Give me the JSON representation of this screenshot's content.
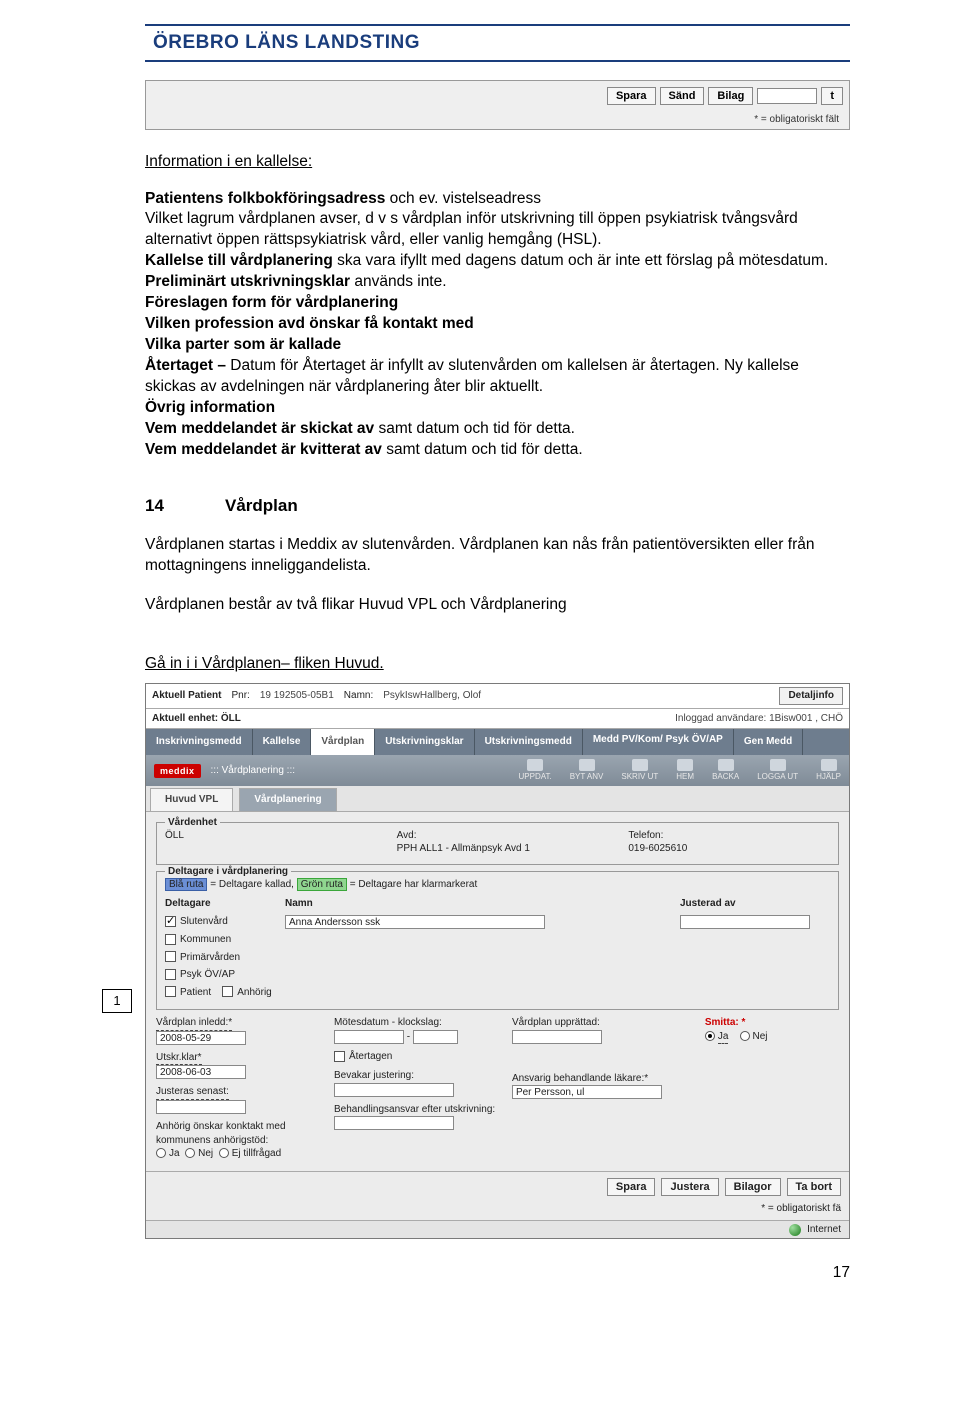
{
  "header": {
    "title": "ÖREBRO LÄNS LANDSTING"
  },
  "top_strip": {
    "buttons": {
      "spara": "Spara",
      "sand": "Sänd",
      "bilag": "Bilag",
      "blank": "t"
    },
    "footnote": "* = obligatoriskt fält"
  },
  "section_info": {
    "heading": "Information i en kallelse:",
    "p1_prefix_bold": "Patientens folkbokföringsadress",
    "p1_rest": " och ev. vistelseadress",
    "p2": "Vilket lagrum vårdplanen avser, d v s vårdplan inför utskrivning till öppen psykiatrisk tvångsvård alternativt öppen rättspsykiatrisk vård, eller vanlig hemgång (HSL).",
    "p3_bold": "Kallelse till vårdplanering",
    "p3_rest": " ska vara ifyllt med dagens datum och är inte ett förslag på mötesdatum.",
    "p4_bold": "Preliminärt utskrivningsklar",
    "p4_rest": " används inte.",
    "p5_bold": "Föreslagen form för vårdplanering",
    "p6_bold": "Vilken profession avd önskar få kontakt med",
    "p7_bold": "Vilka parter som är kallade",
    "p8_bold": "Återtaget – ",
    "p8_rest": "Datum för Återtaget är infyllt av slutenvården om kallelsen är återtagen. Ny kallelse skickas av avdelningen när vårdplanering åter blir aktuellt.",
    "p9_bold": "Övrig information",
    "p10_bold": "Vem meddelandet är skickat av",
    "p10_rest": " samt datum och tid för detta.",
    "p11_bold": "Vem meddelandet är kvitterat av",
    "p11_rest": " samt datum och tid för detta."
  },
  "section14": {
    "num": "14",
    "title": "Vårdplan",
    "p1": "Vårdplanen startas i Meddix av slutenvården. Vårdplanen kan nås från patientöversikten eller från mottagningens inneliggandelista.",
    "p2": "Vårdplanen består av två flikar Huvud VPL och Vårdplanering",
    "p3": "Gå in i i Vårdplanen– fliken Huvud."
  },
  "side_badge": "1",
  "app": {
    "top1": {
      "patient_lbl": "Aktuell Patient",
      "pnr_lbl": "Pnr:",
      "pnr_val": "19 192505-05B1",
      "namn_lbl": "Namn:",
      "namn_val": "PsykIswHallberg, Olof",
      "detaljinfo": "Detaljinfo"
    },
    "top2": {
      "enhet_lbl": "Aktuell enhet: ÖLL",
      "logged_lbl": "Inloggad användare: 1Bisw001 , CHÖ"
    },
    "tabs": {
      "t1": "Inskrivningsmedd",
      "t2": "Kallelse",
      "t3": "Vårdplan",
      "t4": "Utskrivningsklar",
      "t5": "Utskrivningsmedd",
      "t6": "Medd PV/Kom/\nPsyk ÖV/AP",
      "t7": "Gen Medd"
    },
    "crumb": {
      "brand": "meddix",
      "section": "::: Vårdplanering :::",
      "icons": {
        "i1": "UPPDAT.",
        "i2": "BYT ANV",
        "i3": "SKRIV UT",
        "i4": "HEM",
        "i5": "BACKA",
        "i6": "LOGGA UT",
        "i7": "HJÄLP"
      }
    },
    "sub_tabs": {
      "t1": "Huvud VPL",
      "t2": "Vårdplanering"
    },
    "vardenhet": {
      "legend": "Vårdenhet",
      "col1_lbl": "",
      "col1_val": "ÖLL",
      "col2_lbl": "Avd:",
      "col2_val": "PPH ALL1 - Allmänpsyk Avd 1",
      "col3_lbl": "Telefon:",
      "col3_val": "019-6025610"
    },
    "deltagare": {
      "legend": "Deltagare i vårdplanering",
      "legend2_a": "Blå ruta",
      "legend2_b": " = Deltagare kallad, ",
      "legend2_c": "Grön ruta",
      "legend2_d": " = Deltagare har klarmarkerat",
      "hdr1": "Deltagare",
      "hdr2": "Namn",
      "hdr3": "Justerad av",
      "rows": {
        "r1_lbl": "Slutenvård",
        "r1_namn": "Anna Andersson ssk",
        "r2_lbl": "Kommunen",
        "r3_lbl": "Primärvården",
        "r4_lbl": "Psyk ÖV/AP",
        "r5_a": "Patient",
        "r5_b": "Anhörig"
      }
    },
    "bottom": {
      "c1_lbl1": "Vårdplan inledd:*",
      "c1_val1": "2008-05-29",
      "c1_lbl2": "Utskr.klar*",
      "c1_val2": "2008-06-03",
      "c1_lbl3": "Justeras senast:",
      "c1_lbl4": "Anhörig önskar konktakt med kommunens anhörigstöd:",
      "c1_r1": "Ja",
      "c1_r2": "Nej",
      "c1_r3": "Ej tillfrågad",
      "c2_lbl1": "Mötesdatum - klockslag:",
      "c2_dash": "-",
      "c2_lbl2": "Återtagen",
      "c2_lbl3": "Bevakar justering:",
      "c2_lbl4": "Behandlingsansvar efter utskrivning:",
      "c3_lbl1": "Vårdplan upprättad:",
      "c3_lbl2": "Ansvarig behandlande läkare:*",
      "c3_val2": "Per Persson, ul",
      "c4_lbl1": "Smitta: *",
      "c4_r1": "Ja",
      "c4_r2": "Nej"
    },
    "footer": {
      "b1": "Spara",
      "b2": "Justera",
      "b3": "Bilagor",
      "b4": "Ta bort",
      "note": "* = obligatoriskt fä"
    },
    "status": {
      "label": "Internet"
    }
  },
  "page_number": "17"
}
